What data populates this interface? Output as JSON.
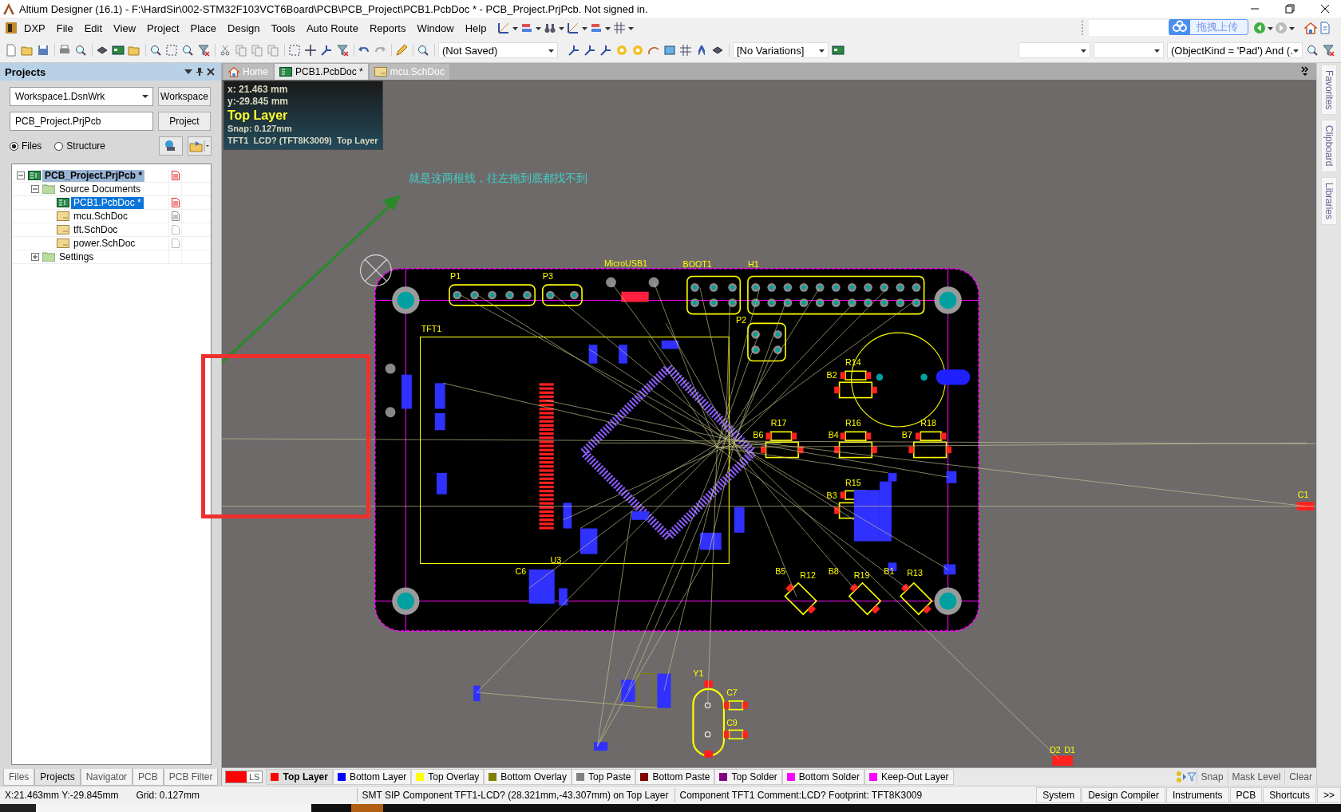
{
  "window": {
    "title": "Altium Designer (16.1) - F:\\HardSir\\002-STM32F103VCT6Board\\PCB\\PCB_Project\\PCB1.PcbDoc * - PCB_Project.PrjPcb. Not signed in."
  },
  "menu": [
    "DXP",
    "File",
    "Edit",
    "View",
    "Project",
    "Place",
    "Design",
    "Tools",
    "Auto Route",
    "Reports",
    "Window",
    "Help"
  ],
  "toolbar": {
    "upload_button": "拖拽上传",
    "saved_state": "(Not Saved)",
    "variations": "[No Variations]",
    "filter": "(ObjectKind = 'Pad') And (."
  },
  "projects_panel": {
    "title": "Projects",
    "workspace": "Workspace1.DsnWrk",
    "workspace_button": "Workspace",
    "project": "PCB_Project.PrjPcb",
    "project_button": "Project",
    "view_options": [
      {
        "label": "Files",
        "selected": true
      },
      {
        "label": "Structure",
        "selected": false
      }
    ],
    "tree": [
      {
        "label": "PCB_Project.PrjPcb *",
        "kind": "project",
        "modified": true,
        "expanded": true,
        "selected": false,
        "children": [
          {
            "label": "Source Documents",
            "kind": "folder",
            "expanded": true,
            "selected": false,
            "children": [
              {
                "label": "PCB1.PcbDoc *",
                "kind": "pcb",
                "modified": true,
                "selected": true
              },
              {
                "label": "mcu.SchDoc",
                "kind": "sch",
                "modified": false,
                "open": true,
                "selected": false
              },
              {
                "label": "tft.SchDoc",
                "kind": "sch",
                "modified": false,
                "open": false,
                "selected": false
              },
              {
                "label": "power.SchDoc",
                "kind": "sch",
                "modified": false,
                "open": false,
                "selected": false
              }
            ]
          },
          {
            "label": "Settings",
            "kind": "folder",
            "expanded": false,
            "selected": false
          }
        ]
      }
    ],
    "tabs": [
      {
        "label": "Files",
        "selected": false
      },
      {
        "label": "Projects",
        "selected": true
      },
      {
        "label": "Navigator",
        "selected": false
      },
      {
        "label": "PCB",
        "selected": false
      },
      {
        "label": "PCB Filter",
        "selected": false
      }
    ]
  },
  "doc_tabs": [
    {
      "label": "Home",
      "kind": "home",
      "selected": false
    },
    {
      "label": "PCB1.PcbDoc *",
      "kind": "pcb",
      "selected": true
    },
    {
      "label": "mcu.SchDoc",
      "kind": "sch",
      "selected": false
    }
  ],
  "hud": {
    "x": "x: 21.463 mm",
    "y": "y:-29.845 mm",
    "layer": "Top Layer",
    "snap": "Snap: 0.127mm",
    "component": "TFT1  LCD? (TFT8K3009)  Top Layer"
  },
  "annotation": "就是这两根线，往左拖到底都找不到",
  "designators": [
    "P1",
    "P3",
    "MicroUSB1",
    "BOOT1",
    "H1",
    "P2",
    "TFT1",
    "R14",
    "B2",
    "R17",
    "R16",
    "R18",
    "B6",
    "B4",
    "B7",
    "R15",
    "B3",
    "B5",
    "R12",
    "B8",
    "R19",
    "B1",
    "R13",
    "Y1",
    "C7",
    "C9",
    "C1",
    "D2",
    "D1",
    "C6",
    "U3"
  ],
  "side_panels": [
    "Favorites",
    "Clipboard",
    "Libraries"
  ],
  "current_layer": "LS",
  "layer_tabs": [
    {
      "label": "Top Layer",
      "color": "#ff0000",
      "selected": true
    },
    {
      "label": "Bottom Layer",
      "color": "#0000ff",
      "selected": false
    },
    {
      "label": "Top Overlay",
      "color": "#ffff00",
      "selected": false
    },
    {
      "label": "Bottom Overlay",
      "color": "#808000",
      "selected": false
    },
    {
      "label": "Top Paste",
      "color": "#808080",
      "selected": false
    },
    {
      "label": "Bottom Paste",
      "color": "#800000",
      "selected": false
    },
    {
      "label": "Top Solder",
      "color": "#800080",
      "selected": false
    },
    {
      "label": "Bottom Solder",
      "color": "#ff00ff",
      "selected": false
    },
    {
      "label": "Keep-Out Layer",
      "color": "#ff00ff",
      "selected": false
    }
  ],
  "layer_tools": [
    "Snap",
    "Mask Level",
    "Clear"
  ],
  "status_bar": {
    "coords": "X:21.463mm Y:-29.845mm",
    "grid": "Grid: 0.127mm",
    "selection": "SMT SIP Component TFT1-LCD? (28.321mm,-43.307mm) on Top Layer",
    "component": "Component TFT1 Comment:LCD? Footprint: TFT8K3009",
    "panels": [
      "System",
      "Design Compiler",
      "Instruments",
      "PCB",
      "Shortcuts",
      ">>"
    ]
  }
}
